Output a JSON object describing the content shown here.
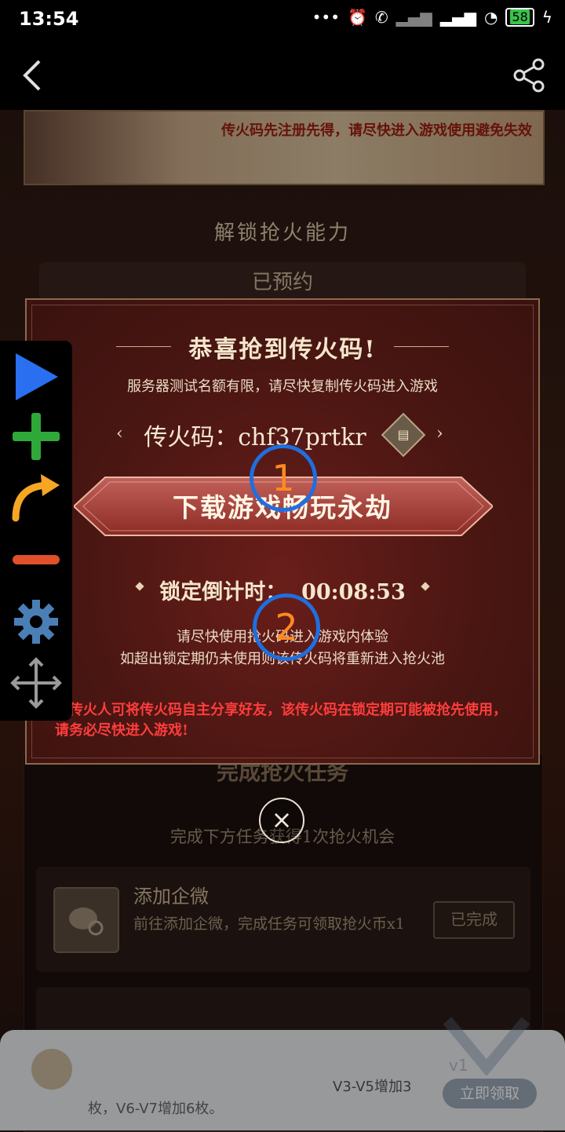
{
  "status_bar": {
    "time": "13:54",
    "battery": "58",
    "icons": [
      "more-dots-icon",
      "alarm-icon",
      "call-forward-icon",
      "signal-icon",
      "signal-icon",
      "wifi-icon",
      "battery-icon",
      "charging-icon"
    ]
  },
  "nav": {
    "back_icon": "chevron-left-icon",
    "share_icon": "share-icon"
  },
  "background": {
    "banner_text": "传火码先注册先得，请尽快进入游戏使用避免失效",
    "unlock_title": "解锁抢火能力",
    "reserved_label": "已预约",
    "task_title": "完成抢火任务",
    "task_subtitle": "完成下方任务获得1次抢火机会",
    "task": {
      "name": "添加企微",
      "desc": "前往添加企微，完成任务可领取抢火币x1",
      "status": "已完成"
    },
    "toast": {
      "text1": "V3-V5增加3",
      "text2": "枚，V6-V7增加6枚。",
      "button": "立即领取",
      "badge": "v1"
    }
  },
  "modal": {
    "title": "恭喜抢到传火码!",
    "subtitle": "服务器测试名额有限，请尽快复制传火码进入游戏",
    "code_label": "传火码：",
    "code_value": "chf37prtkr",
    "download_label": "下载游戏畅玩永劫",
    "lock_label": "锁定倒计时：",
    "lock_time": "00:08:53",
    "note_line1": "请尽快使用抢火码进入游戏内体验",
    "note_line2": "如超出锁定期仍未使用则该传火码将重新进入抢火池",
    "warning": "因传火人可将传火码自主分享好友，该传火码在锁定期可能被抢先使用，请务必尽快进入游戏!",
    "close_icon": "close-icon"
  },
  "markers": {
    "first": "1",
    "second": "2"
  },
  "toolbar": {
    "items": [
      "play-icon",
      "plus-icon",
      "redo-arrow-icon",
      "minus-icon",
      "gear-icon",
      "move-arrows-icon"
    ]
  },
  "colors": {
    "accent_red": "#ff3d3d",
    "marker_blue": "#1e6fe0",
    "marker_orange": "#ff8a1e",
    "play_blue": "#2a6ff0",
    "add_green": "#2fa83a",
    "redo_orange": "#f5a623",
    "minus_red": "#e0502a",
    "gear_blue": "#4a7fb5"
  }
}
